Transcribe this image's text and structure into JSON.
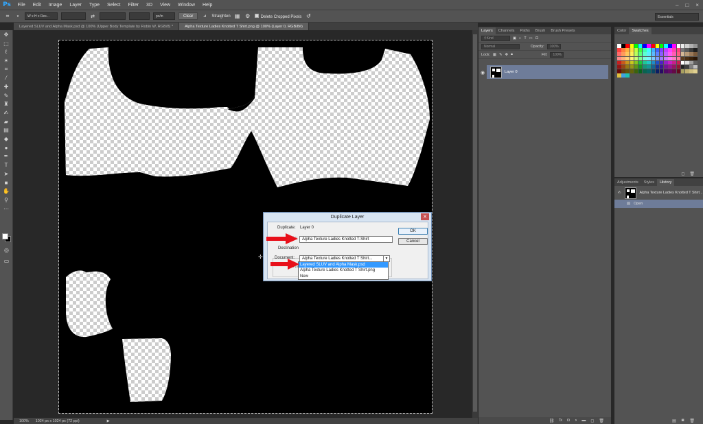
{
  "menu": [
    "File",
    "Edit",
    "Image",
    "Layer",
    "Type",
    "Select",
    "Filter",
    "3D",
    "View",
    "Window",
    "Help"
  ],
  "app_logo": "Ps",
  "options": {
    "ratio_field": "W x H x Res...",
    "unit_field": "px/in",
    "clear": "Clear",
    "straighten": "Straighten",
    "delete_cropped": "Delete Cropped Pixels",
    "workspace": "Essentials"
  },
  "tabs": [
    {
      "label": "Layered SLUV and Alpha Mask.psd @ 100% (Upper Body Template by Robin W, RGB/8) *",
      "active": false
    },
    {
      "label": "Alpha Texture Ladies Knotted T Shirt.png @ 100% (Layer 0, RGB/8#)",
      "active": true
    }
  ],
  "status": {
    "zoom": "100%",
    "doc_info": "1024 px x 1024 px (72 ppi)"
  },
  "layers_panel": {
    "tabs": [
      "Layers",
      "Channels",
      "Paths",
      "Brush",
      "Brush Presets"
    ],
    "filter": "Kind",
    "blend_mode": "Normal",
    "opacity_label": "Opacity:",
    "opacity_value": "100%",
    "lock_label": "Lock:",
    "fill_label": "Fill:",
    "fill_value": "100%",
    "layer_name": "Layer 0"
  },
  "color_panel": {
    "tabs": [
      "Color",
      "Swatches"
    ],
    "swatches": [
      "#ffffff",
      "#000000",
      "#ff0000",
      "#ffff00",
      "#00ff00",
      "#00ffff",
      "#0000ff",
      "#ff00ff",
      "#ff0000",
      "#ffff00",
      "#00ff00",
      "#00ffff",
      "#0000ff",
      "#ff00ff",
      "#ffffff",
      "#ebebeb",
      "#cfcfcf",
      "#b0b0b0",
      "#949494",
      "#ff4040",
      "#ff8040",
      "#ffb040",
      "#ffe040",
      "#c0ff40",
      "#40ff40",
      "#40ffb0",
      "#40ffff",
      "#40b0ff",
      "#4060ff",
      "#8040ff",
      "#c040ff",
      "#ff40ff",
      "#ff40b0",
      "#ff4080",
      "#787878",
      "#5a5a5a",
      "#3c3c3c",
      "#1e1e1e",
      "#ff6b6b",
      "#ff9a5c",
      "#ffc65c",
      "#fff05c",
      "#b8ff5c",
      "#5cff7a",
      "#5cffd0",
      "#5cf0ff",
      "#5cbaff",
      "#5c82ff",
      "#8c5cff",
      "#c25cff",
      "#ff5cf5",
      "#ff5cb4",
      "#ff5c80",
      "#d4b896",
      "#b89a78",
      "#9a7a5a",
      "#7a5a3c",
      "#ff8a8a",
      "#ffb07a",
      "#ffd27a",
      "#fff47a",
      "#caff7a",
      "#7aff94",
      "#7affdc",
      "#7af4ff",
      "#7acaff",
      "#7a9cff",
      "#a07aff",
      "#cf7aff",
      "#ff7af7",
      "#ff7ac4",
      "#ff7a9c",
      "#5c3c1e",
      "#4a2e14",
      "#3a220c",
      "#2a1606",
      "#c81e1e",
      "#c85a1e",
      "#c8961e",
      "#c8c81e",
      "#82c81e",
      "#1ec83c",
      "#1ec896",
      "#1ec8c8",
      "#1e8cc8",
      "#1e50c8",
      "#501ec8",
      "#961ec8",
      "#c81ec8",
      "#c81e8c",
      "#c81e50",
      "#ffffff",
      "#e0e0e0",
      "#a0a0a0",
      "#606060",
      "#961414",
      "#964614",
      "#967814",
      "#969614",
      "#5a9614",
      "#149628",
      "#149678",
      "#149696",
      "#146496",
      "#143296",
      "#3c1496",
      "#781496",
      "#961496",
      "#961464",
      "#961432",
      "#202020",
      "#404040",
      "#808080",
      "#c0c0c0",
      "#640a0a",
      "#643c0a",
      "#64500a",
      "#64640a",
      "#3c640a",
      "#0a641e",
      "#0a6450",
      "#0a6464",
      "#0a4664",
      "#0a1e64",
      "#280a64",
      "#500a64",
      "#640a64",
      "#640a46",
      "#640a1e",
      "#a8a060",
      "#c0b070",
      "#d0c080",
      "#e0d090",
      "#e0c040",
      "#40a0e0",
      "#20c0b0"
    ]
  },
  "history_panel": {
    "tabs": [
      "Adjustments",
      "Styles",
      "History"
    ],
    "snapshot": "Alpha Texture Ladies Knotted T Shirt...",
    "items": [
      "Open"
    ]
  },
  "dialog": {
    "title": "Duplicate Layer",
    "duplicate_label": "Duplicate:",
    "duplicate_value": "Layer 0",
    "as_label": "As:",
    "as_value": "Alpha Texture Ladies Knotted T-Shirt",
    "ok": "OK",
    "cancel": "Cancel",
    "destination_label": "Destination",
    "document_label": "Document:",
    "document_value": "Alpha Texture Ladies Knotted T Shirt...",
    "name_label": "Na",
    "options": [
      "Layered SLUV and Alpha Mask.psd",
      "Alpha Texture Ladies Knotted T Shirt.png",
      "New"
    ],
    "selected_option": "Layered SLUV and Alpha Mask.psd"
  },
  "colors": {
    "selection_blue": "#6e7c99",
    "dropdown_highlight": "#3399ff",
    "arrow_red": "#e8101a"
  }
}
